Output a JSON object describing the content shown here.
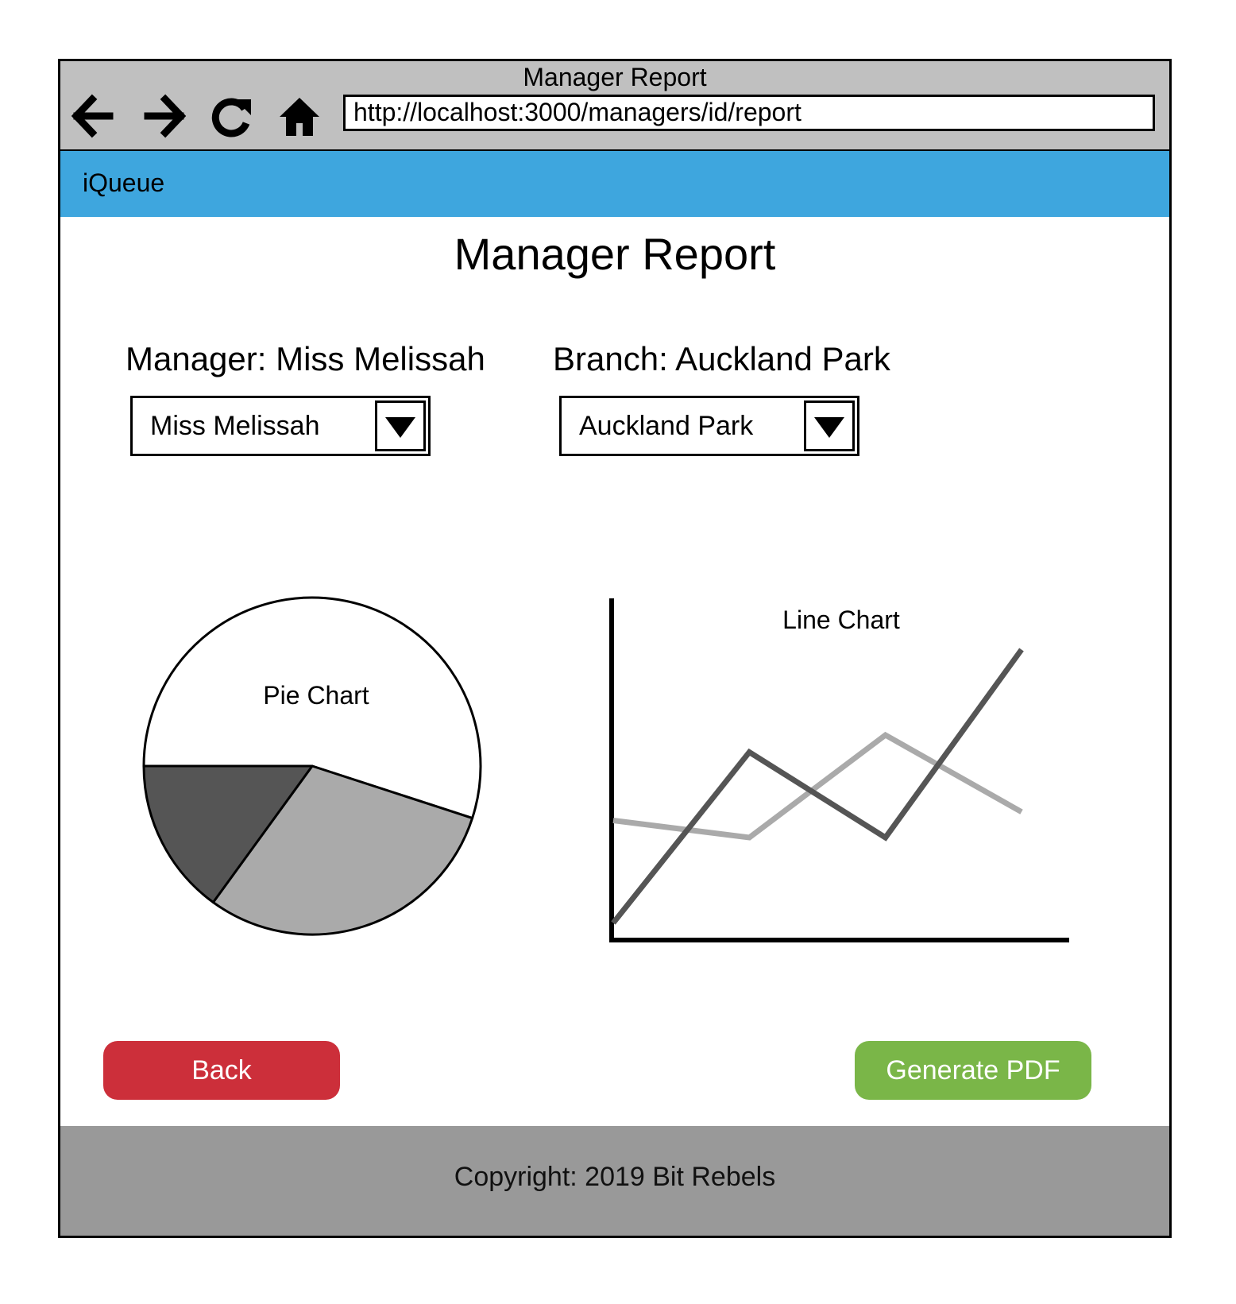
{
  "window": {
    "title": "Manager Report",
    "url": "http://localhost:3000/managers/id/report"
  },
  "navigation": {
    "back_icon": "arrow-left-icon",
    "forward_icon": "arrow-right-icon",
    "reload_icon": "reload-icon",
    "home_icon": "home-icon"
  },
  "brand": {
    "name": "iQueue",
    "bar_color": "#3ea6de"
  },
  "page": {
    "title": "Manager Report"
  },
  "filters": {
    "manager": {
      "label": "Manager: Miss Melissah",
      "selected": "Miss Melissah"
    },
    "branch": {
      "label": "Branch: Auckland Park",
      "selected": "Auckland Park"
    }
  },
  "chart_data": [
    {
      "type": "pie",
      "title": "Pie Chart",
      "slices": [
        {
          "value": 0.55,
          "color": "#ffffff"
        },
        {
          "value": 0.3,
          "color": "#aaaaaa"
        },
        {
          "value": 0.15,
          "color": "#555555"
        }
      ]
    },
    {
      "type": "line",
      "title": "Line Chart",
      "x": [
        0,
        1,
        2,
        3
      ],
      "series": [
        {
          "values": [
            0.2,
            2.2,
            1.2,
            3.4
          ],
          "color": "#555555"
        },
        {
          "values": [
            1.4,
            1.2,
            2.4,
            1.5
          ],
          "color": "#aaaaaa"
        }
      ],
      "ylim": [
        0,
        4.0
      ]
    }
  ],
  "actions": {
    "back_label": "Back",
    "back_color": "#cc2f3a",
    "pdf_label": "Generate PDF",
    "pdf_color": "#7ab648"
  },
  "footer": {
    "text": "Copyright: 2019 Bit Rebels"
  }
}
